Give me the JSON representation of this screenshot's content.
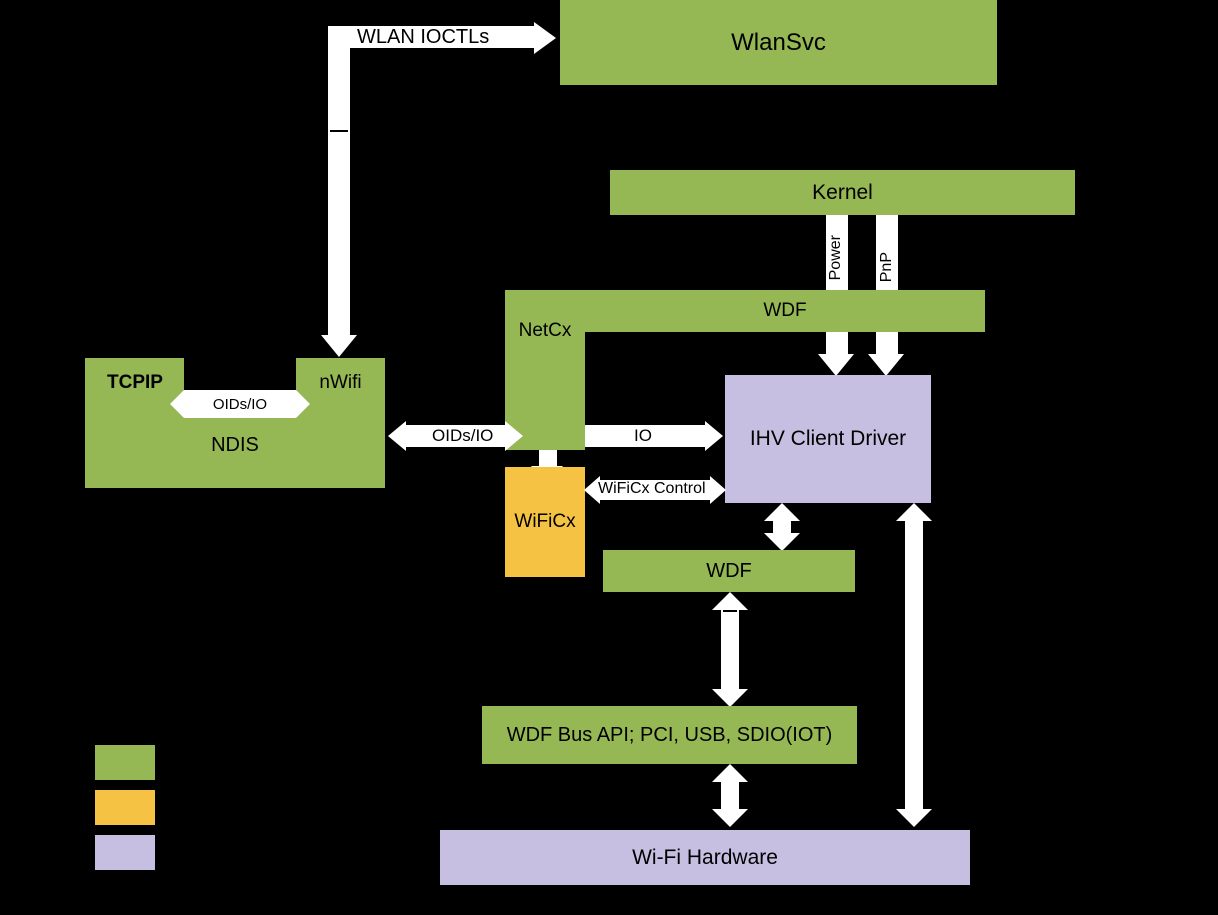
{
  "boxes": {
    "wlansvc": "WlanSvc",
    "tcpip": "TCPIP",
    "nwifi": "nWifi",
    "ndis": "NDIS",
    "kernel": "Kernel",
    "netcx": "NetCx",
    "wdf_top": "WDF",
    "wificx": "WiFiCx",
    "ihv": "IHV Client Driver",
    "wdf_mid": "WDF",
    "wdf_bus": "WDF Bus API; PCI, USB, SDIO(IOT)",
    "wifi_hardware": "Wi-Fi Hardware"
  },
  "labels": {
    "wlan_ioctls": "WLAN IOCTLs",
    "oids_io_1": "OIDs/IO",
    "oids_io_2": "OIDs/IO",
    "io": "IO",
    "wificx_control": "WiFiCx Control",
    "power": "Power",
    "pnp": "PnP"
  },
  "colors": {
    "green": "#95b754",
    "orange": "#f5c243",
    "purple": "#c7bfe1"
  }
}
